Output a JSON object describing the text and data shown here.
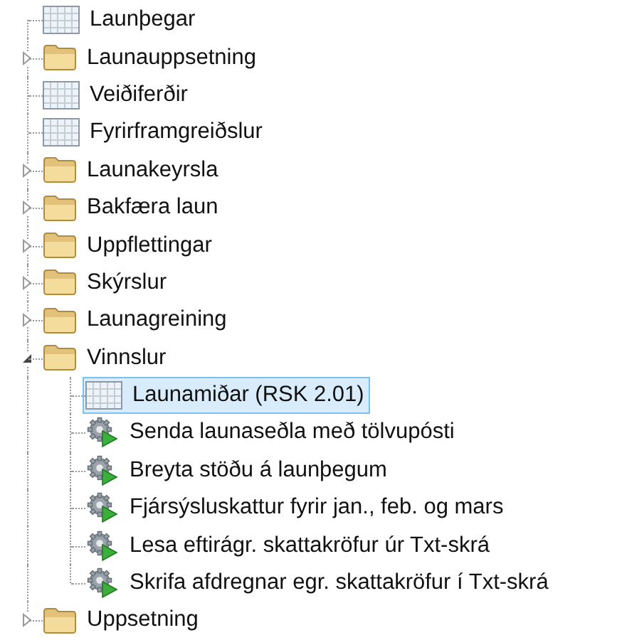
{
  "tree": [
    {
      "label": "Launþegar",
      "kind": "table",
      "selected": false
    },
    {
      "label": "Launauppsetning",
      "kind": "folder",
      "expanded": false,
      "selected": false
    },
    {
      "label": "Veiðiferðir",
      "kind": "table",
      "selected": false
    },
    {
      "label": "Fyrirframgreiðslur",
      "kind": "table",
      "selected": false
    },
    {
      "label": "Launakeyrsla",
      "kind": "folder",
      "expanded": false,
      "selected": false
    },
    {
      "label": "Bakfæra laun",
      "kind": "folder",
      "expanded": false,
      "selected": false
    },
    {
      "label": "Uppflettingar",
      "kind": "folder",
      "expanded": false,
      "selected": false
    },
    {
      "label": "Skýrslur",
      "kind": "folder",
      "expanded": false,
      "selected": false
    },
    {
      "label": "Launagreining",
      "kind": "folder",
      "expanded": false,
      "selected": false
    },
    {
      "label": "Vinnslur",
      "kind": "folder",
      "expanded": true,
      "selected": false,
      "children": [
        {
          "label": "Launamiðar (RSK 2.01)",
          "kind": "table",
          "selected": true
        },
        {
          "label": "Senda launaseðla með tölvupósti",
          "kind": "action",
          "selected": false
        },
        {
          "label": "Breyta stöðu á launþegum",
          "kind": "action",
          "selected": false
        },
        {
          "label": "Fjársýsluskattur fyrir jan., feb. og mars",
          "kind": "action",
          "selected": false
        },
        {
          "label": "Lesa eftirágr. skattakröfur úr Txt-skrá",
          "kind": "action",
          "selected": false
        },
        {
          "label": "Skrifa afdregnar egr. skattakröfur í Txt-skrá",
          "kind": "action",
          "selected": false
        }
      ]
    },
    {
      "label": "Uppsetning",
      "kind": "folder",
      "expanded": false,
      "selected": false
    }
  ]
}
